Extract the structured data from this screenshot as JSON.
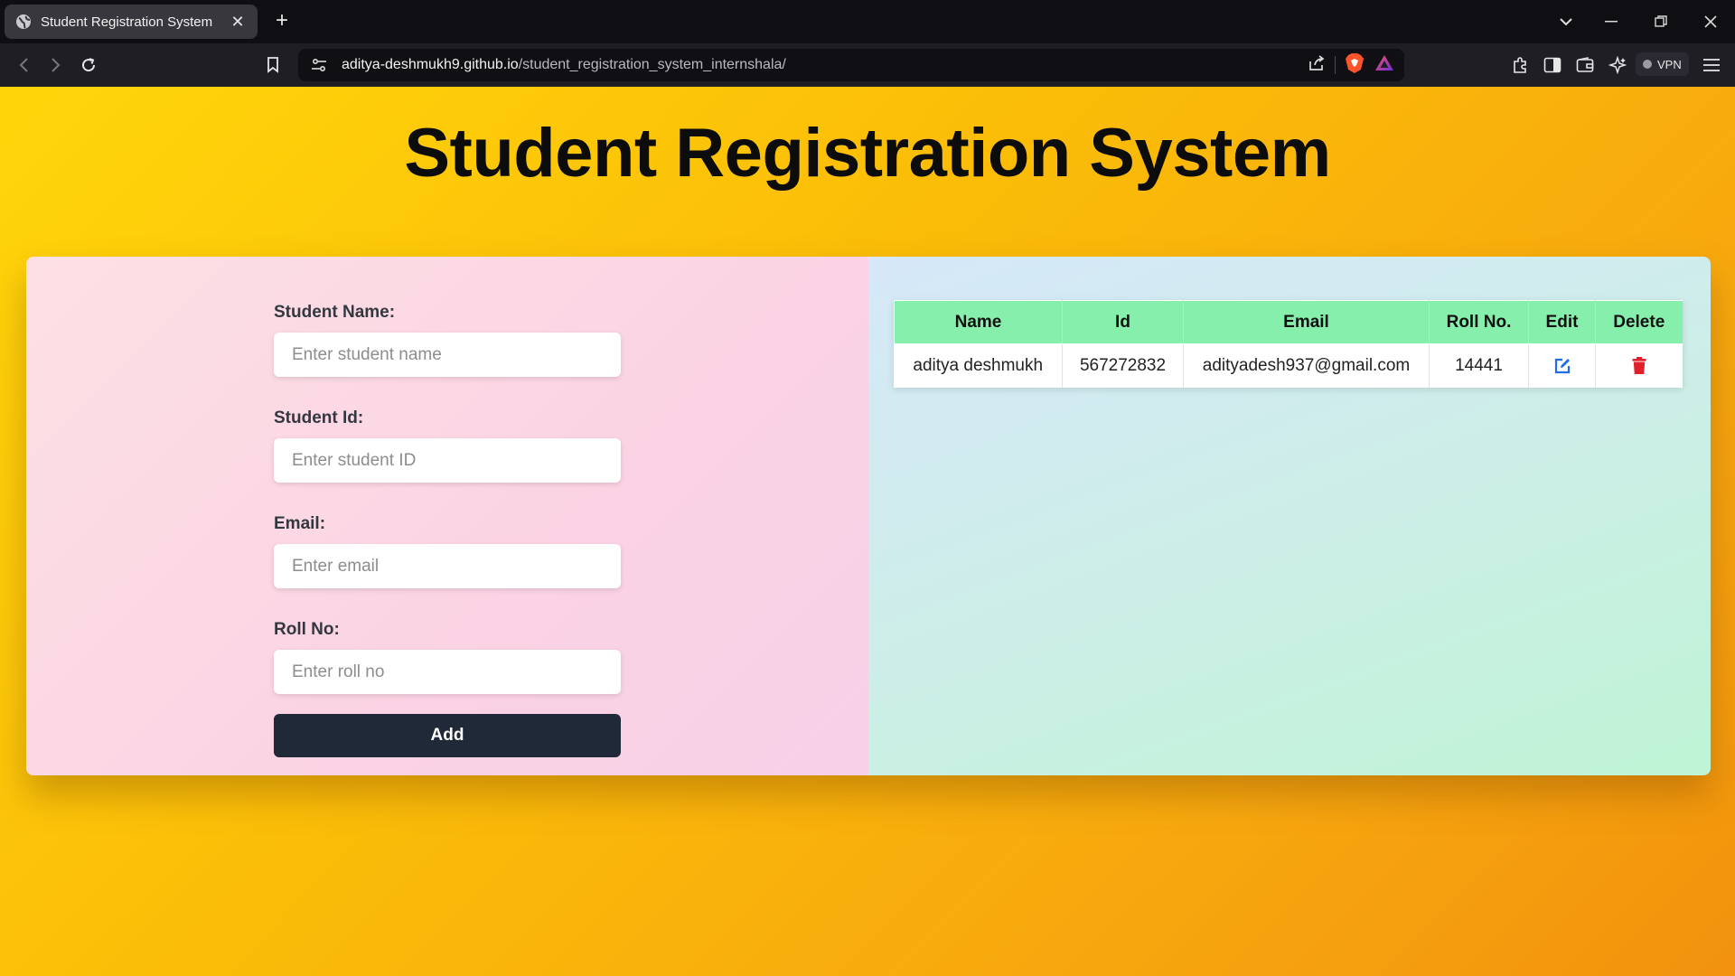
{
  "browser": {
    "tab_title": "Student Registration System",
    "url_host": "aditya-deshmukh9.github.io",
    "url_path": "/student_registration_system_internshala/",
    "vpn_label": "VPN"
  },
  "page": {
    "title": "Student Registration System"
  },
  "form": {
    "name_label": "Student Name:",
    "name_placeholder": "Enter student name",
    "id_label": "Student Id:",
    "id_placeholder": "Enter student ID",
    "email_label": "Email:",
    "email_placeholder": "Enter email",
    "roll_label": "Roll No:",
    "roll_placeholder": "Enter roll no",
    "add_label": "Add"
  },
  "table": {
    "headers": [
      "Name",
      "Id",
      "Email",
      "Roll No.",
      "Edit",
      "Delete"
    ],
    "rows": [
      {
        "name": "aditya deshmukh",
        "id": "567272832",
        "email": "adityadesh937@gmail.com",
        "roll": "14441",
        "edit_icon": "edit-icon",
        "delete_icon": "trash-icon"
      }
    ]
  },
  "colors": {
    "header_bg": "#86efac",
    "add_button": "#1f2937",
    "edit_icon": "#1d6ee8",
    "delete_icon": "#e0202a"
  }
}
